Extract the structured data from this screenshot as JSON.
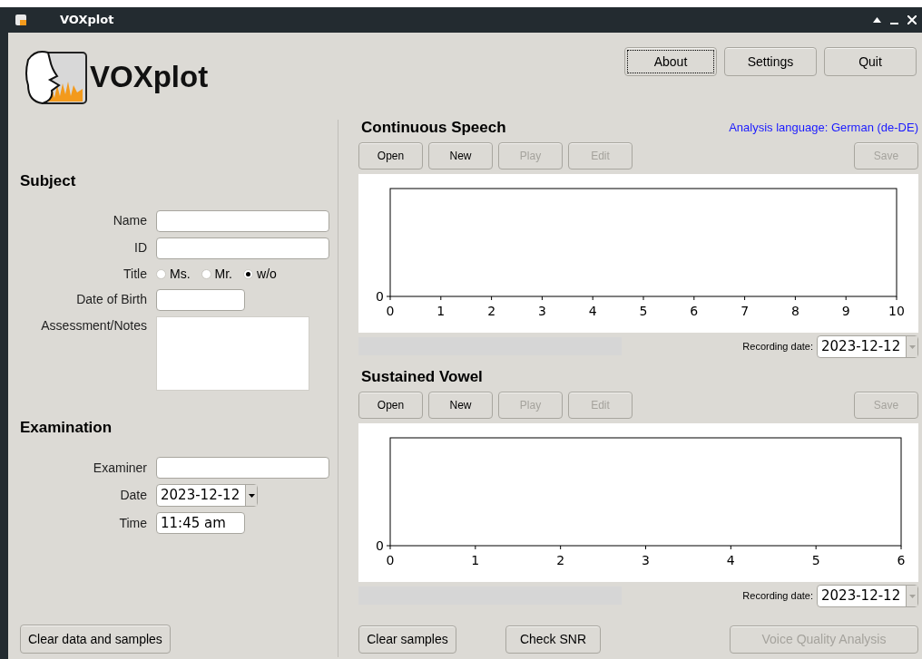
{
  "window": {
    "title": "VOXplot"
  },
  "header": {
    "logo_text": "VOXplot",
    "buttons": [
      {
        "label": "About",
        "focused": true
      },
      {
        "label": "Settings",
        "focused": false
      },
      {
        "label": "Quit",
        "focused": false
      }
    ]
  },
  "subject": {
    "heading": "Subject",
    "fields": [
      {
        "kind": "text",
        "label": "Name"
      },
      {
        "kind": "text",
        "label": "ID"
      },
      {
        "kind": "radio",
        "label": "Title",
        "options": [
          {
            "label": "Ms.",
            "selected": false
          },
          {
            "label": "Mr.",
            "selected": false
          },
          {
            "label": "w/o",
            "selected": true
          }
        ]
      },
      {
        "kind": "short",
        "label": "Date of Birth"
      },
      {
        "kind": "area",
        "label": "Assessment/Notes"
      }
    ]
  },
  "examination": {
    "heading": "Examination",
    "fields": [
      {
        "kind": "text",
        "label": "Examiner"
      },
      {
        "kind": "combo",
        "label": "Date",
        "value": "2023-12-12"
      },
      {
        "kind": "short",
        "label": "Time",
        "value": "11:45 am"
      }
    ]
  },
  "clear_all_button": "Clear data and samples",
  "analysis_language": "Analysis language: German (de-DE)",
  "sections": [
    {
      "title": "Continuous Speech",
      "buttons": [
        {
          "label": "Open",
          "disabled": false
        },
        {
          "label": "New",
          "disabled": false
        },
        {
          "label": "Play",
          "disabled": true
        },
        {
          "label": "Edit",
          "disabled": true
        },
        {
          "label": "Save",
          "disabled": true
        }
      ],
      "plot": {
        "x_tick_labels": [
          "0",
          "1",
          "2",
          "3",
          "4",
          "5",
          "6",
          "7",
          "8",
          "9",
          "10"
        ],
        "y_tick_labels": [
          "0"
        ]
      },
      "recording_date_label": "Recording date:",
      "recording_date": "2023-12-12"
    },
    {
      "title": "Sustained Vowel",
      "buttons": [
        {
          "label": "Open",
          "disabled": false
        },
        {
          "label": "New",
          "disabled": false
        },
        {
          "label": "Play",
          "disabled": true
        },
        {
          "label": "Edit",
          "disabled": true
        },
        {
          "label": "Save",
          "disabled": true
        }
      ],
      "plot": {
        "x_tick_labels": [
          "0",
          "1",
          "2",
          "3",
          "4",
          "5",
          "6"
        ],
        "y_tick_labels": [
          "0"
        ]
      },
      "recording_date_label": "Recording date:",
      "recording_date": "2023-12-12"
    }
  ],
  "bottom_buttons": [
    {
      "label": "Clear samples",
      "disabled": false
    },
    {
      "label": "Check SNR",
      "disabled": false
    },
    {
      "label": "Voice Quality Analysis",
      "disabled": true
    }
  ]
}
